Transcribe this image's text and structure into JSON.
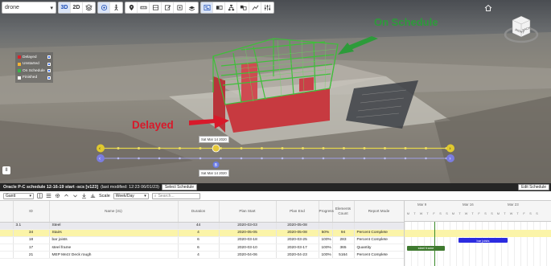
{
  "toolbar": {
    "view_select": "drone",
    "mode_3d": "3D",
    "mode_2d": "2D"
  },
  "legend": [
    {
      "label": "Delayed",
      "color": "#d9222a"
    },
    {
      "label": "Unstarted",
      "color": "#f2b134"
    },
    {
      "label": "On Schedule",
      "color": "#3ab54a"
    },
    {
      "label": "Finished",
      "color": "#ffffff"
    }
  ],
  "nav_cube": {
    "right": "RIGHT",
    "back": "BACK"
  },
  "annotations": {
    "on_schedule": "On Schedule",
    "delayed": "Delayed"
  },
  "timeline": {
    "current_date": "Sat Mar 14 2020",
    "baseline_date": "Sat Mar 14 2020",
    "baseline_marker": "B",
    "progress_fraction": 0.33
  },
  "schedule": {
    "title": "Oracle P-C schedule 12-16-19 start -scs [v123]",
    "modified": "(last modified: 12:23 06/01/23)",
    "select_button": "Select Schedule",
    "edit_button": "Edit Schedule",
    "view_select": "Gantt",
    "scale_label": "Scale",
    "scale_value": "Week/Day",
    "search_placeholder": "Search..."
  },
  "columns": [
    "ID",
    "Name (31)",
    "Duration",
    "Plan Start",
    "Plan End",
    "Progress",
    "Elements Count",
    "Report Mode"
  ],
  "rows": [
    {
      "id": "3.1",
      "name": "Steel",
      "duration": "44",
      "start": "2020-03-03",
      "end": "2020-05-08",
      "progress": "",
      "count": "",
      "mode": ""
    },
    {
      "id": "34",
      "name": "Stairs",
      "duration": "4",
      "start": "2020-05-05",
      "end": "2020-05-08",
      "progress": "50%",
      "count": "94",
      "mode": "Percent Complete"
    },
    {
      "id": "18",
      "name": "bar joists",
      "duration": "6",
      "start": "2020-03-18",
      "end": "2020-03-25",
      "progress": "100%",
      "count": "283",
      "mode": "Percent Complete"
    },
    {
      "id": "17",
      "name": "steel frame",
      "duration": "6",
      "start": "2020-03-10",
      "end": "2020-03-17",
      "progress": "100%",
      "count": "365",
      "mode": "Quantity"
    },
    {
      "id": "21",
      "name": "MEP Mezz Deck rough",
      "duration": "4",
      "start": "2020-04-06",
      "end": "2020-04-23",
      "progress": "100%",
      "count": "5164",
      "mode": "Percent Complete"
    }
  ],
  "gantt": {
    "weeks": [
      "Mar 9",
      "Mar 16",
      "Mar 23"
    ],
    "days": [
      "M",
      "T",
      "W",
      "T",
      "F",
      "S",
      "S",
      "M",
      "T",
      "W",
      "T",
      "F",
      "S",
      "S",
      "M",
      "T",
      "W",
      "T",
      "F",
      "S",
      "S"
    ],
    "bars": [
      {
        "label": "bar joists",
        "color": "#2b2be0"
      },
      {
        "label": "steel frame",
        "color": "#3f7a2f"
      }
    ]
  }
}
